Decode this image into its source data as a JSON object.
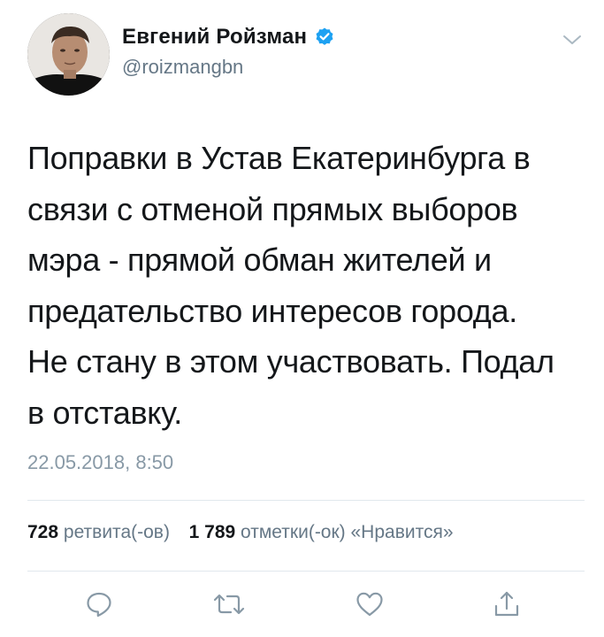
{
  "author": {
    "display_name": "Евгений Ройзман",
    "handle": "@roizmangbn",
    "verified": true
  },
  "tweet": {
    "text": "Поправки в Устав Екатеринбурга в\nсвязи с отменой прямых выборов\nмэра - прямой обман жителей  и\nпредательство интересов города.\nНе стану в этом участвовать. Подал\nв отставку.",
    "timestamp": "22.05.2018, 8:50"
  },
  "stats": {
    "retweets_count": "728",
    "retweets_label": "ретвита(-ов)",
    "likes_count": "1 789",
    "likes_label": "отметки(-ок) «Нравится»"
  },
  "icons": {
    "verified": "verified-badge-icon",
    "caret": "chevron-down-icon",
    "reply": "reply-icon",
    "retweet": "retweet-icon",
    "like": "heart-icon",
    "share": "share-icon"
  },
  "colors": {
    "verified_blue": "#1da1f2",
    "secondary_text": "#657786",
    "timestamp_text": "#8899a6",
    "divider": "#e1e8ed"
  }
}
